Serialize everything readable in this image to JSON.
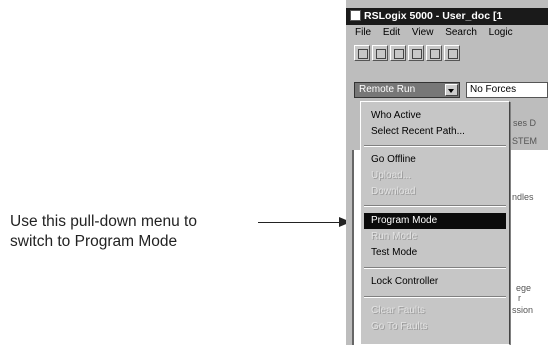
{
  "callout": {
    "line1": "Use this pull-down menu to",
    "line2": "switch to Program Mode"
  },
  "window": {
    "title": "RSLogix 5000 - User_doc [1"
  },
  "menubar": [
    "File",
    "Edit",
    "View",
    "Search",
    "Logic"
  ],
  "controller": {
    "mode": "Remote Run",
    "forces": "No Forces",
    "background_text": [
      "ses D",
      "STEM",
      "ndles",
      "ege",
      "r",
      "ssion"
    ]
  },
  "mode_menu": {
    "items": [
      {
        "label": "Who Active",
        "state": "normal"
      },
      {
        "label": "Select Recent Path...",
        "state": "normal"
      },
      {
        "label": "Go Offline",
        "state": "normal"
      },
      {
        "label": "Upload...",
        "state": "disabled"
      },
      {
        "label": "Download",
        "state": "disabled"
      },
      {
        "label": "Program Mode",
        "state": "selected"
      },
      {
        "label": "Run Mode",
        "state": "disabled"
      },
      {
        "label": "Test Mode",
        "state": "normal"
      },
      {
        "label": "Lock Controller",
        "state": "normal"
      },
      {
        "label": "Clear Faults",
        "state": "disabled"
      },
      {
        "label": "Go To Faults",
        "state": "disabled"
      }
    ]
  }
}
